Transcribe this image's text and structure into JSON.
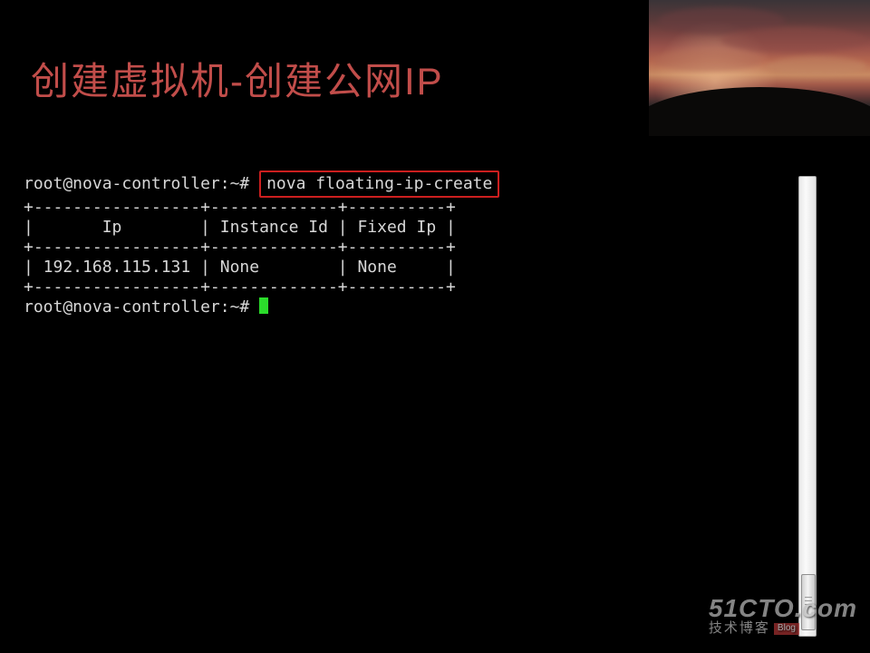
{
  "title": "创建虚拟机-创建公网IP",
  "terminal": {
    "prompt": "root@nova-controller:~#",
    "command": "nova floating-ip-create",
    "columns": [
      "Ip",
      "Instance Id",
      "Fixed Ip"
    ],
    "divider_top": "+-----------------+-------------+----------+",
    "header_row": "|       Ip        | Instance Id | Fixed Ip |",
    "divider_mid": "+-----------------+-------------+----------+",
    "data_row": "| 192.168.115.131 | None        | None     |",
    "divider_bot": "+-----------------+-------------+----------+",
    "row": {
      "ip": "192.168.115.131",
      "instance_id": "None",
      "fixed_ip": "None"
    }
  },
  "watermark": {
    "line1": "51CTO.com",
    "line2": "技术博客",
    "badge": "Blog"
  }
}
